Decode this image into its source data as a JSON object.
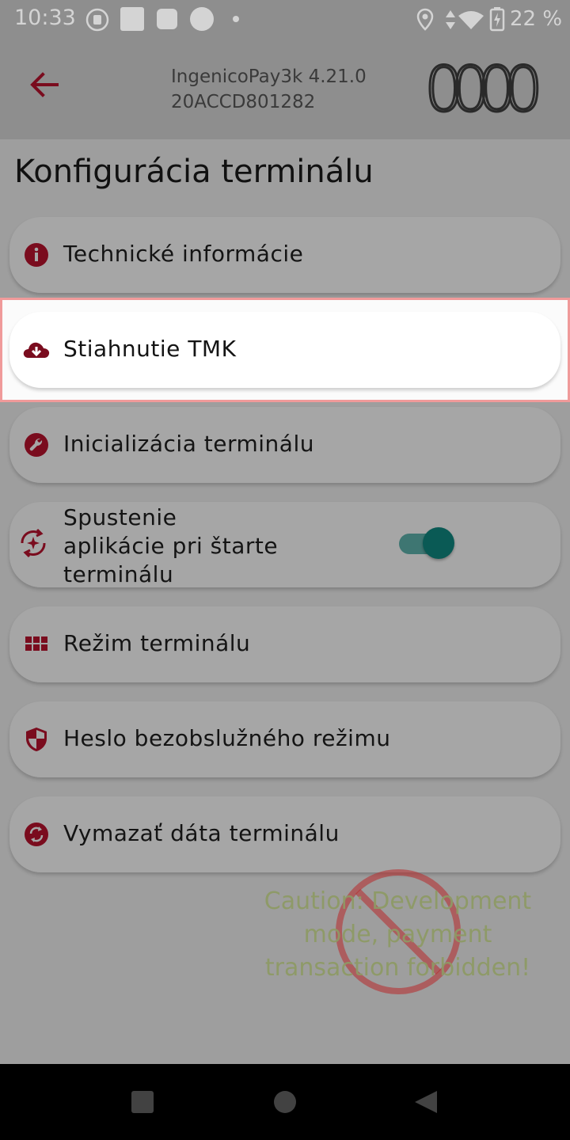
{
  "status_bar": {
    "time": "10:33",
    "battery_percent": "22 %",
    "icons": [
      "sim-icon",
      "square-icon",
      "rounded-square-icon",
      "circle-icon",
      "dot-icon",
      "location-icon",
      "data-arrows-icon",
      "wifi-icon",
      "battery-icon"
    ]
  },
  "app_bar": {
    "app_name": "IngenicoPay3k 4.21.0",
    "serial": "20ACCD801282",
    "counter": "0000"
  },
  "page": {
    "title": "Konfigurácia terminálu"
  },
  "menu": {
    "items": [
      {
        "label": "Technické informácie",
        "icon": "info-icon"
      },
      {
        "label": "Stiahnutie TMK",
        "icon": "cloud-download-icon"
      },
      {
        "label": "Inicializácia terminálu",
        "icon": "wrench-icon"
      },
      {
        "label_lines": [
          "Spustenie",
          "aplikácie pri štarte",
          "terminálu"
        ],
        "icon": "startup-sync-icon",
        "toggle_on": true
      },
      {
        "label": "Režim terminálu",
        "icon": "grid-icon"
      },
      {
        "label": "Heslo bezobslužného režimu",
        "icon": "shield-icon"
      },
      {
        "label": "Vymazať dáta terminálu",
        "icon": "reset-icon"
      }
    ]
  },
  "watermark": {
    "text_lines": [
      "Caution: Development",
      "mode, payment",
      "transaction forbidden!"
    ]
  },
  "colors": {
    "accent": "#7a0c1e",
    "toggle": "#0a5a55",
    "background": "#9e9e9e",
    "highlight_border": "#f09a9a"
  }
}
